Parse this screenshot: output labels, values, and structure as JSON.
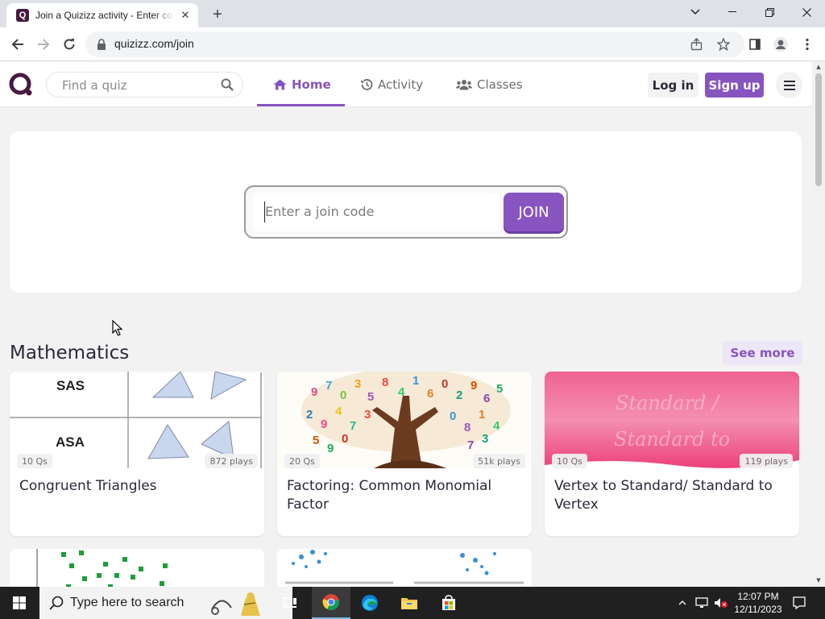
{
  "browser": {
    "tab_title": "Join a Quizizz activity - Enter code -",
    "favicon_letter": "Q",
    "url": "quizizz.com/join"
  },
  "site": {
    "brand_color": "#8854c0",
    "search_placeholder": "Find a quiz",
    "nav": [
      {
        "label": "Home",
        "icon": "home-icon"
      },
      {
        "label": "Activity",
        "icon": "history-icon"
      },
      {
        "label": "Classes",
        "icon": "users-icon"
      }
    ],
    "login_label": "Log in",
    "signup_label": "Sign up"
  },
  "join": {
    "placeholder": "Enter a join code",
    "button_label": "JOIN"
  },
  "section": {
    "title": "Mathematics",
    "see_more_label": "See more"
  },
  "quizzes": [
    {
      "title": "Congruent Triangles",
      "questions": "10 Qs",
      "plays": "872 plays",
      "image_text": [
        "SAS",
        "ASA"
      ]
    },
    {
      "title": "Factoring: Common Monomial Factor",
      "questions": "20 Qs",
      "plays": "51k plays"
    },
    {
      "title": "Vertex to Standard/ Standard to Vertex",
      "questions": "10 Qs",
      "plays": "119 plays",
      "image_text": [
        "Standard /",
        "Standard to"
      ]
    }
  ],
  "taskbar": {
    "search_placeholder": "Type here to search",
    "time": "12:07 PM",
    "date": "12/11/2023"
  }
}
